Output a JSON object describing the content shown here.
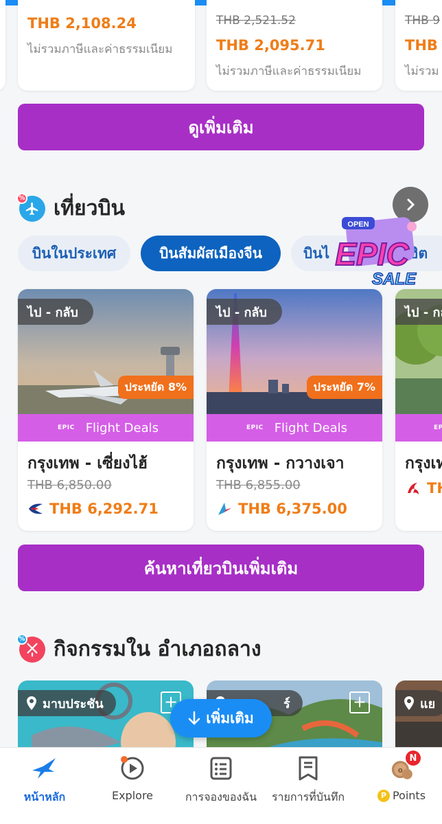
{
  "hotel_cards": [
    {
      "price": "THB 2,108.24",
      "tax_note": "ไม่รวมภาษีและค่าธรรมเนียม"
    },
    {
      "original_price": "THB 2,521.52",
      "price": "THB 2,095.71",
      "tax_note": "ไม่รวมภาษีและค่าธรรมเนียม"
    },
    {
      "original_price": "THB 9",
      "price": "THB 9",
      "tax_note": "ไม่รวม"
    }
  ],
  "see_more_label": "ดูเพิ่มเติม",
  "flights": {
    "title": "เที่ยวบิน",
    "tabs": [
      "บินในประเทศ",
      "บินสัมผัสเมืองจีน",
      "บินไ",
      "สุดฮิต"
    ],
    "epic_badge": {
      "top": "OPEN",
      "word": "EPIC",
      "sub": "SALE"
    },
    "cards": [
      {
        "trip": "ไป - กลับ",
        "saving": "ประหยัด 8%",
        "deal_tag": "EPIC",
        "deal_label": "Flight Deals",
        "route": "กรุงเทพ - เซี่ยงไฮ้",
        "original_price": "THB 6,850.00",
        "price": "THB 6,292.71",
        "airline_icon": "china-eastern-logo"
      },
      {
        "trip": "ไป - กลับ",
        "saving": "ประหยัด 7%",
        "deal_tag": "EPIC",
        "deal_label": "Flight Deals",
        "route": "กรุงเทพ - กวางเจา",
        "original_price": "THB 6,855.00",
        "price": "THB 6,375.00",
        "airline_icon": "china-southern-logo"
      },
      {
        "trip": "ไป - กลับ",
        "deal_tag": "EPIC",
        "route": "กรุงเท",
        "price": "TH",
        "airline_icon": "air-china-logo"
      }
    ],
    "search_more_label": "ค้นหาเที่ยวบินเพิ่มเติม"
  },
  "activities": {
    "title": "กิจกรรมใน อำเภอถลาง",
    "cards": [
      {
        "location": "มาบประชัน"
      },
      {
        "location": "ร์"
      },
      {
        "location": "แย"
      }
    ],
    "more_label": "เพิ่มเติม"
  },
  "bottom_nav": [
    {
      "label": "หน้าหลัก",
      "icon": "home-bird-icon",
      "active": true
    },
    {
      "label": "Explore",
      "icon": "play-circle-icon",
      "active": false
    },
    {
      "label": "การจองของฉัน",
      "icon": "bookings-icon",
      "active": false
    },
    {
      "label": "รายการที่บันทึก",
      "icon": "saved-list-icon",
      "active": false
    },
    {
      "label": "Points",
      "icon": "points-coin-icon",
      "active": false,
      "badge": "N"
    }
  ],
  "colors": {
    "brand_blue": "#1a8df5",
    "purple_button": "#a72fc6",
    "price_orange": "#ef7d18",
    "deal_pink": "#d55ee7"
  }
}
